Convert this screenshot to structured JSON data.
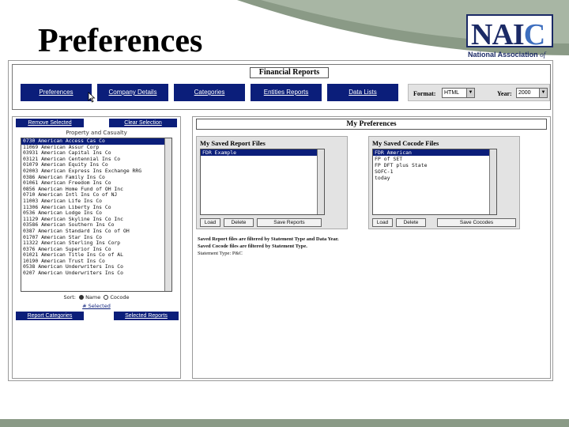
{
  "slide": {
    "title": "Preferences"
  },
  "logo": {
    "mark": "NAI",
    "mark_c": "C",
    "subtitle": "National Association",
    "subtitle_of": "of"
  },
  "app": {
    "panel_title": "Financial Reports",
    "nav": [
      "Preferences",
      "Company Details",
      "Categories",
      "Entities Reports",
      "Data Lists"
    ],
    "format_label": "Format:",
    "format_value": "HTML",
    "year_label": "Year:",
    "year_value": "2000"
  },
  "left": {
    "top_button_1": "Remove Selected",
    "top_button_2": "Clear Selection",
    "property_header": "Property and Casualty",
    "companies": [
      "0730 American Access Cas Co",
      "11069 American Assur Corp",
      "03931 American Capital Ins Co",
      "03121 American Centennial Ins Co",
      "01079 American Equity Ins Co",
      "02003 American Express Ins Exchange RRG",
      "0386 American Family Ins Co",
      "01061 American Freedom Ins Co",
      "0856 American Home Fund of OH Inc",
      "0710 American Intl Ins Co of NJ",
      "11003 American Life Ins Co",
      "11306 American Liberty Ins Co",
      "0536 American Lodge Ins Co",
      "11129 American Skyline Ins Co Inc",
      "03586 American Southern Ins Co",
      "0387 American Standard Ins Co of OH",
      "01707 American Star Ins Co",
      "11322 American Sterling Ins Corp",
      "0376 American Superior Ins Co",
      "01021 American Title Ins Co of AL",
      "10190 American Trust Ins Co",
      "0538 American Underwriters Ins Co",
      "0207 American Underwriters Ins Co"
    ],
    "sort_label": "Sort:",
    "sort_name": "Name",
    "sort_cocode": "Cocode",
    "selected_link": "# Selected",
    "bottom_button_1": "Report Categories",
    "bottom_button_2": "Selected Reports"
  },
  "right": {
    "title": "My Preferences",
    "report_files": {
      "title": "My Saved Report Files",
      "items": [
        "FDR Example"
      ],
      "buttons": [
        "Load",
        "Delete",
        "Save Reports"
      ]
    },
    "cocode_files": {
      "title": "My Saved Cocode Files",
      "items": [
        "FDR American",
        "FP of SET",
        "FP DFT plus State",
        "SOFC-1",
        "today"
      ],
      "buttons": [
        "Load",
        "Delete",
        "Save Cocodes"
      ]
    },
    "notes": [
      "Saved Report files are filtered by Statement Type and Data Year.",
      "Saved Cocode files are filtered by Statement Type.",
      "Statement Type: P&C"
    ]
  }
}
